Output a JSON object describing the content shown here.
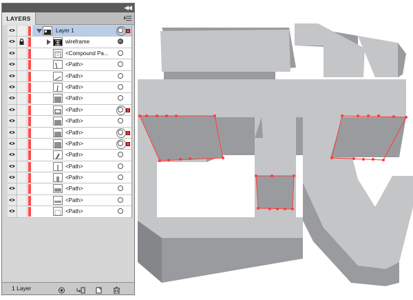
{
  "panel": {
    "tab_label": "LAYERS",
    "footer_count": "1 Layer",
    "layer_color": "#ff4a4a",
    "rows": [
      {
        "label": "Layer 1",
        "kind": "layer"
      },
      {
        "label": "wireframe",
        "kind": "group"
      },
      {
        "label": "<Compound Pa...",
        "kind": "compound"
      },
      {
        "label": "<Path>"
      },
      {
        "label": "<Path>"
      },
      {
        "label": "<Path>"
      },
      {
        "label": "<Path>"
      },
      {
        "label": "<Path>"
      },
      {
        "label": "<Path>"
      },
      {
        "label": "<Path>"
      },
      {
        "label": "<Path>"
      },
      {
        "label": "<Path>"
      },
      {
        "label": "<Path>"
      },
      {
        "label": "<Path>"
      },
      {
        "label": "<Path>"
      },
      {
        "label": "<Path>"
      },
      {
        "label": "<Path>"
      }
    ],
    "footer_buttons": [
      "make-clipping-mask-icon",
      "create-sublayer-icon",
      "create-layer-icon",
      "trash-icon"
    ],
    "menu_icon": "panel-menu-icon",
    "collapse_icon": "collapse-arrows-icon"
  },
  "artwork": {
    "face_color": "#c4c5c7",
    "side_color": "#9a9b9e",
    "shadow_color": "#85868a",
    "selection_color": "#ff3b3b"
  }
}
